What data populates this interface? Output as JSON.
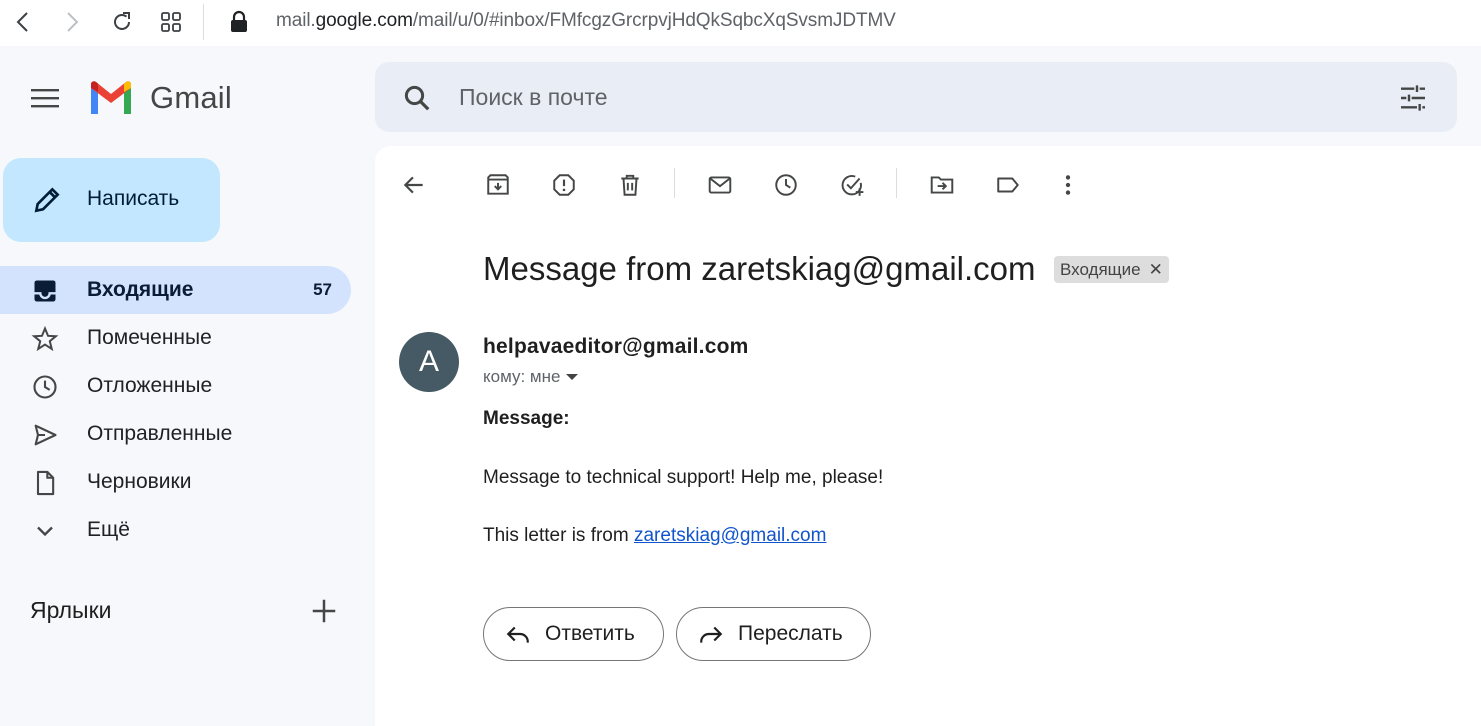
{
  "browser": {
    "url_host_prefix": "mail.",
    "url_host": "google.com",
    "url_path": "/mail/u/0/#inbox/FMfcgzGrcrpvjHdQkSqbcXqSvsmJDTMV"
  },
  "header": {
    "logo_text": "Gmail",
    "search_placeholder": "Поиск в почте"
  },
  "sidebar": {
    "compose_label": "Написать",
    "items": [
      {
        "label": "Входящие",
        "count": "57",
        "icon": "inbox-icon",
        "active": true
      },
      {
        "label": "Помеченные",
        "icon": "star-icon"
      },
      {
        "label": "Отложенные",
        "icon": "clock-icon"
      },
      {
        "label": "Отправленные",
        "icon": "send-icon"
      },
      {
        "label": "Черновики",
        "icon": "draft-icon"
      },
      {
        "label": "Ещё",
        "icon": "chevron-down-icon"
      }
    ],
    "labels_title": "Ярлыки"
  },
  "message": {
    "subject": "Message from zaretskiag@gmail.com",
    "label_chip": "Входящие",
    "avatar_letter": "A",
    "sender": "helpavaeditor@gmail.com",
    "to": "кому: мне",
    "body_title": "Message:",
    "body_line1": "Message to technical support! Help me, please!",
    "body_line2_prefix": "This letter is from ",
    "body_line2_link": "zaretskiag@gmail.com",
    "reply_label": "Ответить",
    "forward_label": "Переслать"
  },
  "colors": {
    "compose_bg": "#c2e7ff",
    "active_nav_bg": "#d3e3fd",
    "search_bg": "#e9eef6",
    "avatar_bg": "#455a64",
    "link": "#1155cc"
  }
}
